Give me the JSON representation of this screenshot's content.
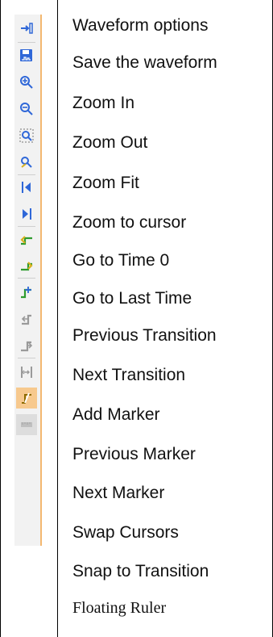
{
  "toolbar": {
    "icons": [
      "waveform-options-icon",
      "save-waveform-icon",
      "zoom-in-icon",
      "zoom-out-icon",
      "zoom-fit-icon",
      "zoom-to-cursor-icon",
      "go-to-time-0-icon",
      "go-to-last-time-icon",
      "previous-transition-icon",
      "next-transition-icon",
      "add-marker-icon",
      "previous-marker-icon",
      "next-marker-icon",
      "swap-cursors-icon",
      "snap-to-transition-icon",
      "floating-ruler-icon"
    ],
    "colors": {
      "accent": "#f4b870",
      "strip_bg": "#f2f2f2",
      "selected_bg": "#f7c98e",
      "blue": "#2f67d8",
      "green": "#2e9b2e",
      "yellow": "#d8b11e"
    }
  },
  "items": [
    {
      "label": "Waveform options"
    },
    {
      "label": "Save the waveform"
    },
    {
      "label": "Zoom In"
    },
    {
      "label": "Zoom Out"
    },
    {
      "label": "Zoom Fit"
    },
    {
      "label": "Zoom to cursor"
    },
    {
      "label": "Go to Time 0"
    },
    {
      "label": "Go to Last Time"
    },
    {
      "label": "Previous Transition"
    },
    {
      "label": "Next Transition"
    },
    {
      "label": "Add Marker"
    },
    {
      "label": "Previous Marker"
    },
    {
      "label": "Next Marker"
    },
    {
      "label": "Swap Cursors"
    },
    {
      "label": "Snap to Transition"
    },
    {
      "label": "Floating Ruler"
    }
  ]
}
